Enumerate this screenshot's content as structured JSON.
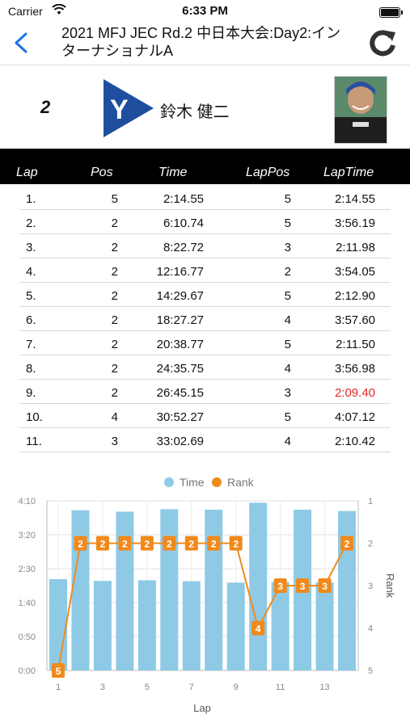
{
  "status": {
    "carrier": "Carrier",
    "time": "6:33 PM"
  },
  "nav": {
    "title": "2021 MFJ JEC  Rd.2 中日本大会:Day2:インターナショナルA"
  },
  "rider": {
    "number": "2",
    "name": "鈴木 健二",
    "logo_letter": "Y"
  },
  "table": {
    "headers": [
      "Lap",
      "Pos",
      "Time",
      "LapPos",
      "LapTime"
    ],
    "rows": [
      {
        "lap": "1.",
        "pos": "5",
        "time": "2:14.55",
        "lappos": "5",
        "laptime": "2:14.55"
      },
      {
        "lap": "2.",
        "pos": "2",
        "time": "6:10.74",
        "lappos": "5",
        "laptime": "3:56.19"
      },
      {
        "lap": "3.",
        "pos": "2",
        "time": "8:22.72",
        "lappos": "3",
        "laptime": "2:11.98"
      },
      {
        "lap": "4.",
        "pos": "2",
        "time": "12:16.77",
        "lappos": "2",
        "laptime": "3:54.05"
      },
      {
        "lap": "5.",
        "pos": "2",
        "time": "14:29.67",
        "lappos": "5",
        "laptime": "2:12.90"
      },
      {
        "lap": "6.",
        "pos": "2",
        "time": "18:27.27",
        "lappos": "4",
        "laptime": "3:57.60"
      },
      {
        "lap": "7.",
        "pos": "2",
        "time": "20:38.77",
        "lappos": "5",
        "laptime": "2:11.50"
      },
      {
        "lap": "8.",
        "pos": "2",
        "time": "24:35.75",
        "lappos": "4",
        "laptime": "3:56.98"
      },
      {
        "lap": "9.",
        "pos": "2",
        "time": "26:45.15",
        "lappos": "3",
        "laptime": "2:09.40",
        "best": true
      },
      {
        "lap": "10.",
        "pos": "4",
        "time": "30:52.27",
        "lappos": "5",
        "laptime": "4:07.12"
      },
      {
        "lap": "11.",
        "pos": "3",
        "time": "33:02.69",
        "lappos": "4",
        "laptime": "2:10.42"
      }
    ]
  },
  "chart_data": {
    "type": "bar+line",
    "legend": [
      "Time",
      "Rank"
    ],
    "xlabel": "Lap",
    "ylabel_right": "Rank",
    "x": [
      1,
      2,
      3,
      4,
      5,
      6,
      7,
      8,
      9,
      10,
      11,
      12,
      13,
      14
    ],
    "x_ticks": [
      "1",
      "3",
      "5",
      "7",
      "9",
      "11",
      "13"
    ],
    "y_left_ticks": [
      "0:00",
      "0:50",
      "1:40",
      "2:30",
      "3:20",
      "4:10"
    ],
    "y_left_range_seconds": [
      0,
      250
    ],
    "y_right_ticks": [
      "1",
      "2",
      "3",
      "4",
      "5"
    ],
    "y_right_range": [
      1,
      5
    ],
    "series": [
      {
        "name": "Time",
        "values_seconds": [
          134.55,
          236.19,
          131.98,
          234.05,
          132.9,
          237.6,
          131.5,
          236.98,
          129.4,
          247.12,
          130.42,
          237.0,
          130.0,
          235.0
        ],
        "color": "#8ecae6"
      },
      {
        "name": "Rank",
        "values": [
          5,
          2,
          2,
          2,
          2,
          2,
          2,
          2,
          2,
          4,
          3,
          3,
          3,
          2
        ],
        "color": "#f08a1c"
      }
    ]
  }
}
